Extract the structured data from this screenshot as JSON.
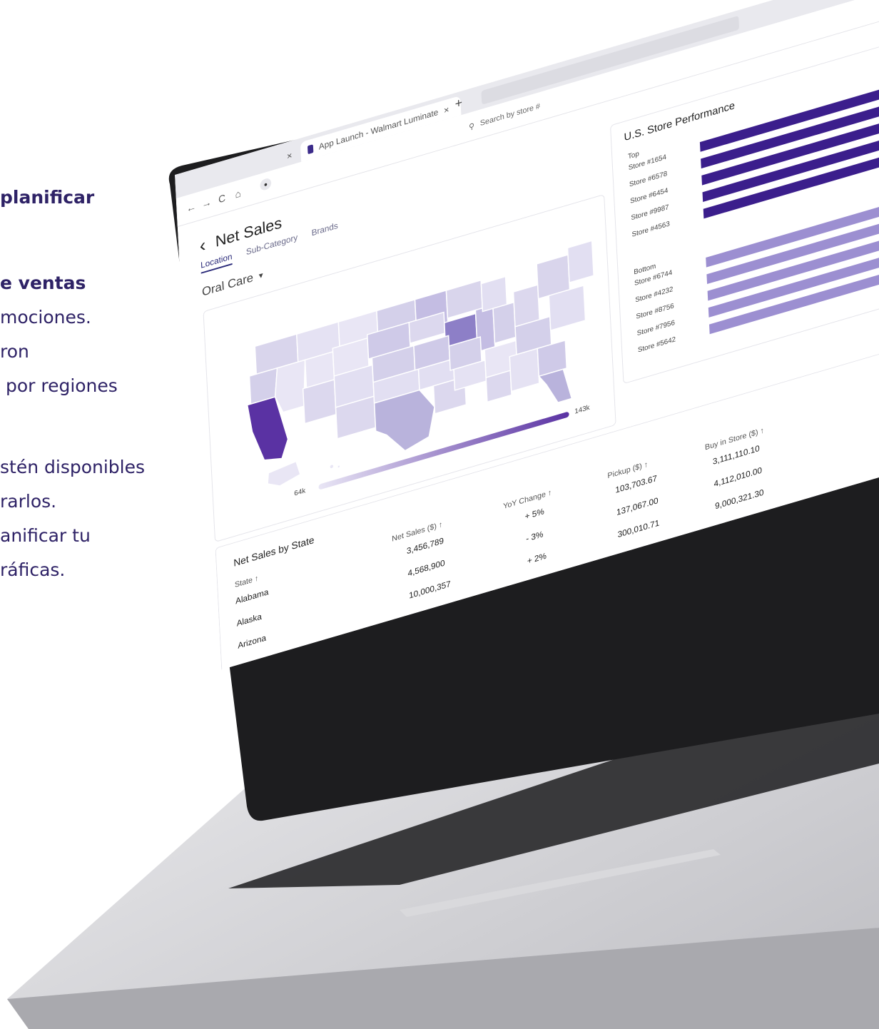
{
  "copy": {
    "line1": "planificar",
    "line2": "e ventas",
    "line3": "mociones.",
    "line4": "ron",
    "line5": " por regiones",
    "line6": "stén disponibles",
    "line7": "rarlos.",
    "line8": "anificar tu",
    "line9": "ráficas."
  },
  "browser": {
    "tab_active": "App Launch - Walmart Luminate",
    "tab_close": "×",
    "tab_prev_close": "×",
    "new_tab": "+",
    "back": "←",
    "forward": "→",
    "reload": "C",
    "home": "⌂",
    "search_placeholder": "Search by store #"
  },
  "page": {
    "title": "Net Sales",
    "back_chevron": "‹",
    "tabs": [
      "Location",
      "Sub-Category",
      "Brands"
    ],
    "filter": "Oral Care",
    "filter_caret": "▾"
  },
  "map": {
    "legend_min": "64k",
    "legend_max": "143k",
    "colors": {
      "low": "#e9e6f5",
      "mid": "#b9b3dc",
      "high": "#5a32a3"
    }
  },
  "performance": {
    "title": "U.S. Store Performance",
    "top_label": "Top",
    "bottom_label": "Bottom",
    "top_stores": [
      "Store #1654",
      "Store #6578",
      "Store #6454",
      "Store #9987",
      "Store #4563"
    ],
    "bottom_stores": [
      "Store #6744",
      "Store #4232",
      "Store #8756",
      "Store #7956",
      "Store #5642"
    ],
    "top_color": "#3b1e8c",
    "bottom_color": "#9c8fd1"
  },
  "table": {
    "title": "Net Sales by State",
    "columns": [
      "State ↑",
      "Net Sales ($) ↑",
      "YoY Change ↑",
      "Pickup ($) ↑",
      "Buy in Store ($) ↑"
    ],
    "rows": [
      [
        "Alabama",
        "3,456,789",
        "+ 5%",
        "103,703.67",
        "3,111,110.10"
      ],
      [
        "Alaska",
        "4,568,900",
        "- 3%",
        "137,067.00",
        "4,112,010.00"
      ],
      [
        "Arizona",
        "10,000,357",
        "+ 2%",
        "300,010.71",
        "9,000,321.30"
      ]
    ]
  }
}
